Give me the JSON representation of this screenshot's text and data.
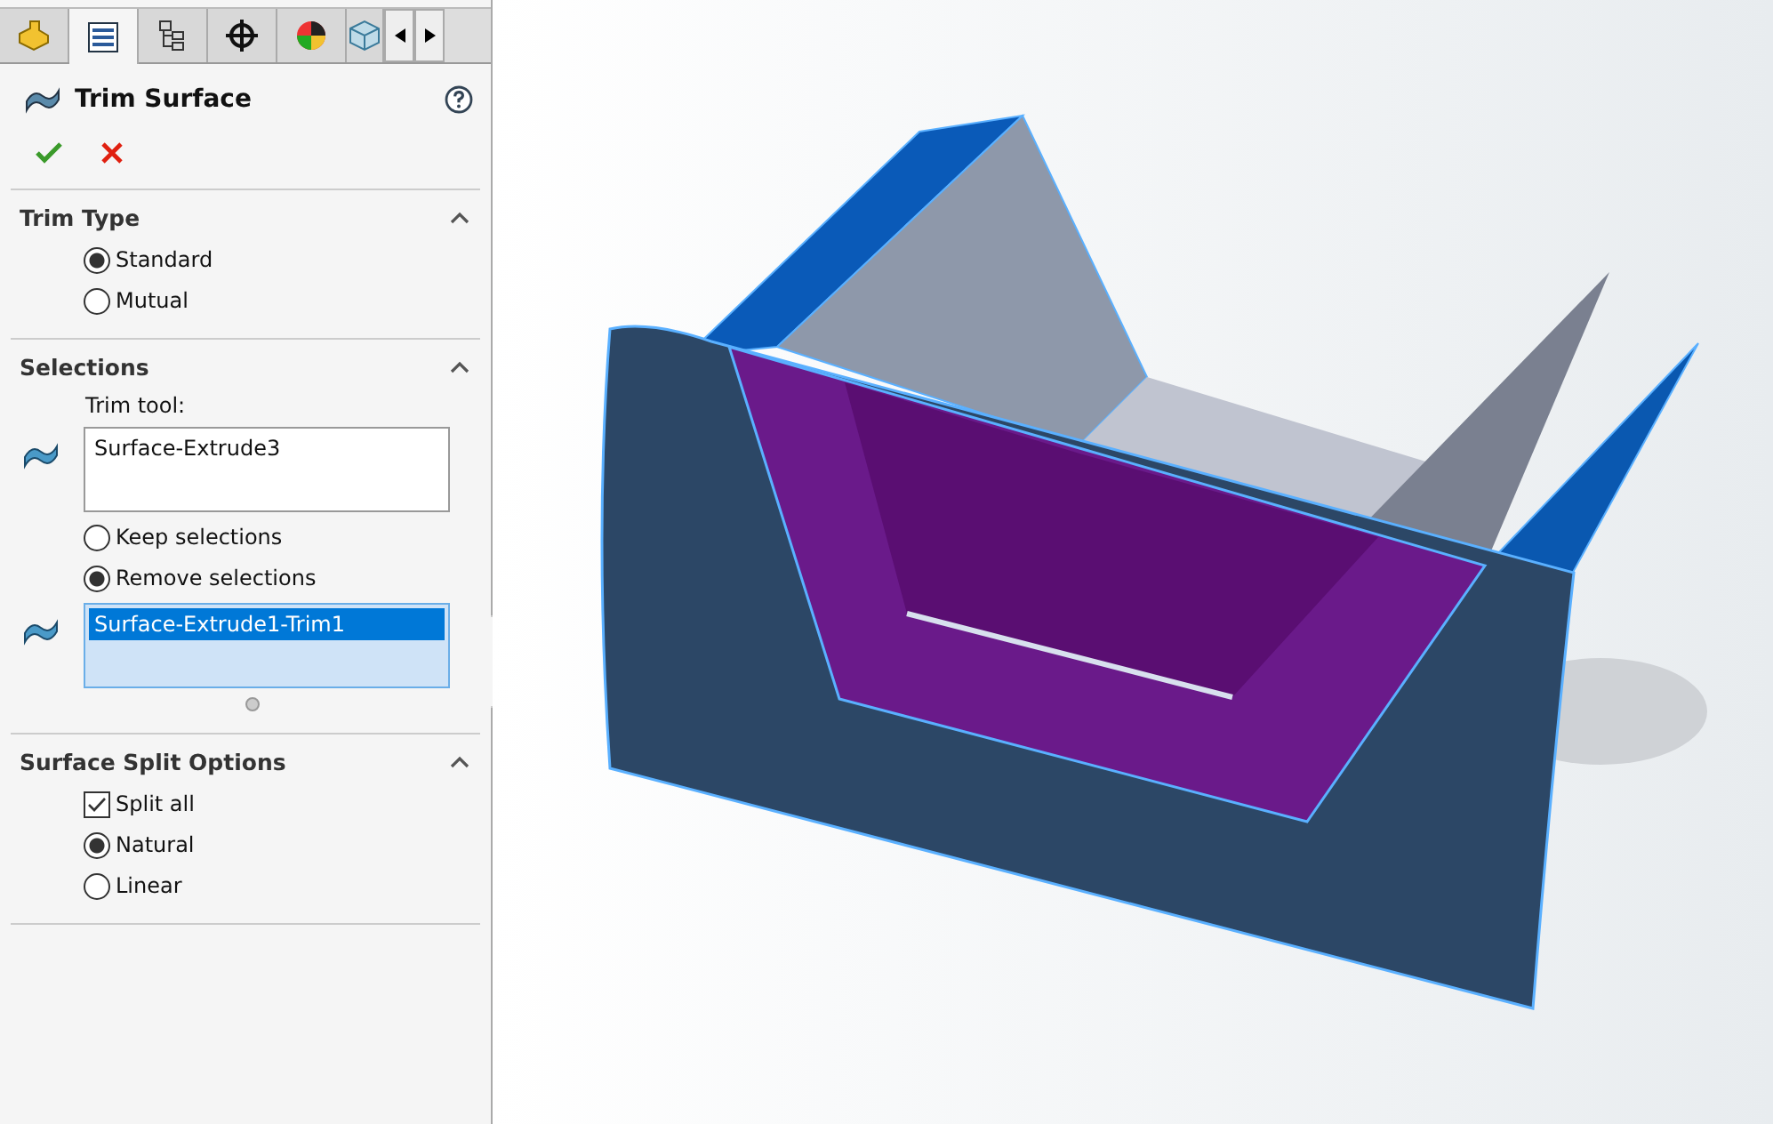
{
  "tabs": [
    {
      "selected": false
    },
    {
      "selected": true
    },
    {
      "selected": false
    },
    {
      "selected": false
    },
    {
      "selected": false
    },
    {
      "selected": false
    }
  ],
  "feature": {
    "title": "Trim Surface"
  },
  "sections": [
    {
      "title": "Trim Type",
      "expanded": true,
      "items": [
        {
          "kind": "radio",
          "label": "Standard",
          "selected": true
        },
        {
          "kind": "radio",
          "label": "Mutual",
          "selected": false
        }
      ]
    },
    {
      "title": "Selections",
      "expanded": true,
      "items": [
        {
          "kind": "label",
          "label": "Trim tool:"
        },
        {
          "kind": "listbox",
          "entries": [
            {
              "label": "Surface-Extrude3",
              "selected": false
            }
          ]
        },
        {
          "kind": "radio",
          "label": "Keep selections",
          "selected": false
        },
        {
          "kind": "radio",
          "label": "Remove selections",
          "selected": true
        },
        {
          "kind": "listbox",
          "entries": [
            {
              "label": "Surface-Extrude1-Trim1",
              "selected": true
            }
          ]
        }
      ]
    },
    {
      "title": "Surface Split Options",
      "expanded": true,
      "items": [
        {
          "kind": "checkbox",
          "label": "Split all",
          "checked": true
        },
        {
          "kind": "radio",
          "label": "Natural",
          "selected": true
        },
        {
          "kind": "radio",
          "label": "Linear",
          "selected": false
        }
      ]
    }
  ]
}
